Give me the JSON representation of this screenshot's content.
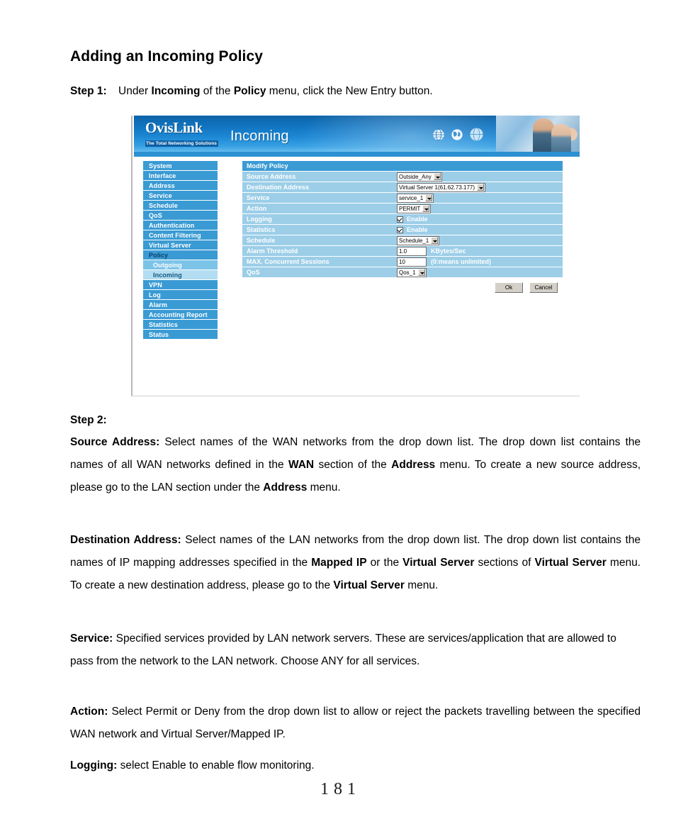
{
  "document": {
    "title": "Adding an Incoming Policy",
    "step1": {
      "label": "Step 1:",
      "text_before": "Under ",
      "bold1": "Incoming",
      "text_mid": " of the ",
      "bold2": "Policy",
      "text_after": " menu, click the New Entry button."
    },
    "step2_label": "Step 2:",
    "paragraphs": {
      "source_address": "Source Address:",
      "source_address_body": " Select names of the WAN networks from the drop down list.   The drop down list contains the names of all WAN networks defined in the ",
      "source_b1": "WAN",
      "source_body2": " section of the ",
      "source_b2": "Address",
      "source_body3": " menu. To create a new source address, please go to the LAN section under the ",
      "source_b3": "Address",
      "source_body4": " menu.",
      "destination_address": "Destination Address:",
      "dest_body1": " Select names of the LAN networks from the drop down list. The drop down list contains the names of IP mapping addresses specified in the ",
      "dest_b1": "Mapped IP",
      "dest_body2": " or the ",
      "dest_b2": "Virtual Server",
      "dest_body3": " sections of ",
      "dest_b3": "Virtual Server",
      "dest_body4": " menu.   To create a new destination address, please go to the ",
      "dest_b4": "Virtual Server",
      "dest_body5": " menu.",
      "service": "Service:",
      "service_body": " Specified services provided by LAN network servers.    These are services/application that are allowed to pass from the network to the LAN network.    Choose ANY for all services.",
      "action": "Action:",
      "action_body": " Select Permit or Deny from the drop down list to allow or reject the packets travelling between the specified WAN network and Virtual Server/Mapped IP.",
      "logging": "Logging:",
      "logging_body": " select Enable to enable flow monitoring."
    },
    "page_number": "181"
  },
  "screenshot": {
    "banner": {
      "logo_main": "OvisLink",
      "logo_sub": "The Total Networking Solutions",
      "title": "Incoming",
      "icons": [
        "globe-icon",
        "globe-icon",
        "globe-icon"
      ]
    },
    "sidebar": {
      "items": [
        {
          "label": "System",
          "type": "top"
        },
        {
          "label": "Interface",
          "type": "top"
        },
        {
          "label": "Address",
          "type": "top"
        },
        {
          "label": "Service",
          "type": "top"
        },
        {
          "label": "Schedule",
          "type": "top"
        },
        {
          "label": "QoS",
          "type": "top"
        },
        {
          "label": "Authentication",
          "type": "top"
        },
        {
          "label": "Content Filtering",
          "type": "top"
        },
        {
          "label": "Virtual Server",
          "type": "top"
        },
        {
          "label": "Policy",
          "type": "active-parent"
        },
        {
          "label": "Outgoing",
          "type": "sub"
        },
        {
          "label": "Incoming",
          "type": "sub-selected"
        },
        {
          "label": "VPN",
          "type": "top"
        },
        {
          "label": "Log",
          "type": "top"
        },
        {
          "label": "Alarm",
          "type": "top"
        },
        {
          "label": "Accounting Report",
          "type": "top"
        },
        {
          "label": "Statistics",
          "type": "top"
        },
        {
          "label": "Status",
          "type": "top"
        }
      ]
    },
    "form": {
      "header": "Modify Policy",
      "rows": [
        {
          "label": "Source Address",
          "control": "select",
          "value": "Outside_Any"
        },
        {
          "label": "Destination Address",
          "control": "select",
          "value": "Virtual Server 1(61.62.73.177)"
        },
        {
          "label": "Service",
          "control": "select",
          "value": "service_1"
        },
        {
          "label": "Action",
          "control": "select",
          "value": "PERMIT"
        },
        {
          "label": "Logging",
          "control": "checkbox",
          "value": "Enable",
          "checked": true
        },
        {
          "label": "Statistics",
          "control": "checkbox",
          "value": "Enable",
          "checked": true
        },
        {
          "label": "Schedule",
          "control": "select",
          "value": "Schedule_1"
        },
        {
          "label": "Alarm Threshold",
          "control": "text",
          "value": "1.0",
          "unit": "KBytes/Sec"
        },
        {
          "label": "MAX. Concurrent Sessions",
          "control": "text",
          "value": "10",
          "unit": "(0:means unlimited)"
        },
        {
          "label": "QoS",
          "control": "select",
          "value": "Qos_1"
        }
      ],
      "buttons": {
        "ok": "Ok",
        "cancel": "Cancel"
      }
    },
    "colors": {
      "banner_blue": "#1277c4",
      "menu_blue": "#3a9bd4",
      "row_blue": "#9ccee8",
      "sub_selected": "#b3ddf2"
    }
  }
}
